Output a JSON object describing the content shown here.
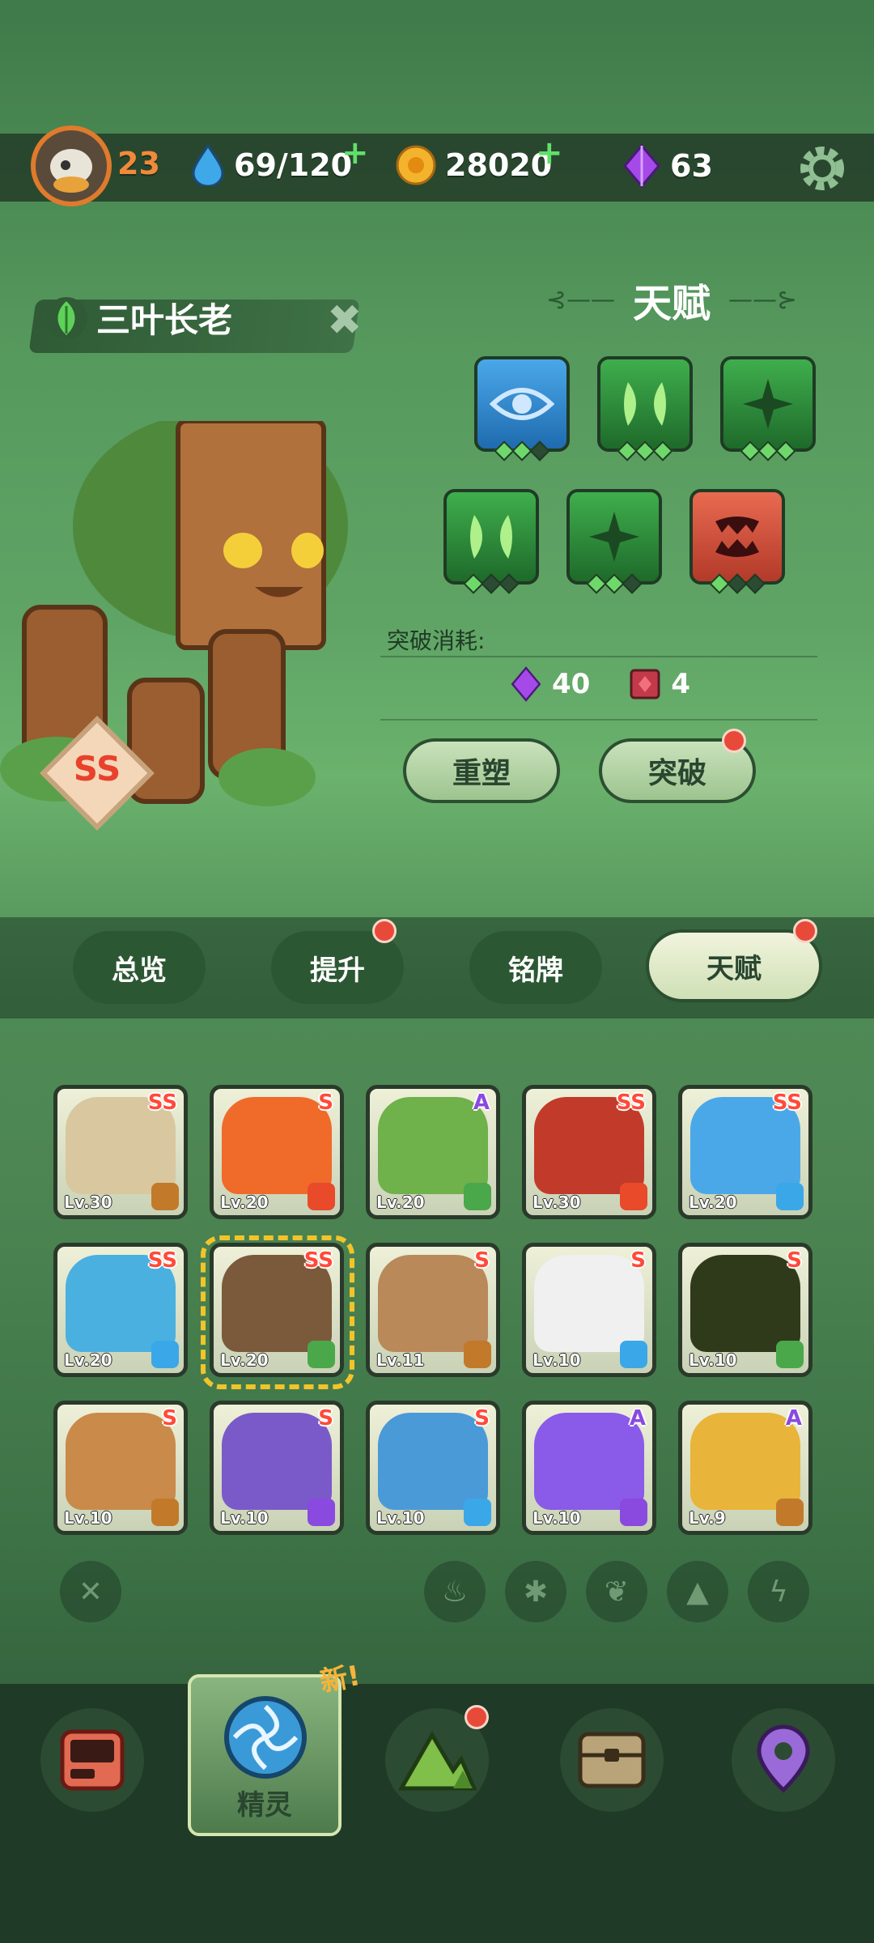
{
  "header": {
    "level": "23",
    "energy": "69/120",
    "coins": "28020",
    "gems": "63"
  },
  "creature": {
    "name": "三叶长老",
    "grade": "SS"
  },
  "talent": {
    "title": "天赋",
    "breakthrough_cost_label": "突破消耗:",
    "cost_gems": "40",
    "cost_items": "4",
    "reshape_label": "重塑",
    "breakthrough_label": "突破"
  },
  "tabs": [
    {
      "label": "总览"
    },
    {
      "label": "提升"
    },
    {
      "label": "铭牌"
    },
    {
      "label": "天赋"
    }
  ],
  "cards": [
    {
      "lv": "Lv.30",
      "grade": "SS"
    },
    {
      "lv": "Lv.20",
      "grade": "S"
    },
    {
      "lv": "Lv.20",
      "grade": "A"
    },
    {
      "lv": "Lv.30",
      "grade": "SS"
    },
    {
      "lv": "Lv.20",
      "grade": "SS"
    },
    {
      "lv": "Lv.20",
      "grade": "SS"
    },
    {
      "lv": "Lv.20",
      "grade": "SS"
    },
    {
      "lv": "Lv.11",
      "grade": "S"
    },
    {
      "lv": "Lv.10",
      "grade": "S"
    },
    {
      "lv": "Lv.10",
      "grade": "S"
    },
    {
      "lv": "Lv.10",
      "grade": "S"
    },
    {
      "lv": "Lv.10",
      "grade": "S"
    },
    {
      "lv": "Lv.10",
      "grade": "S"
    },
    {
      "lv": "Lv.10",
      "grade": "A"
    },
    {
      "lv": "Lv.9",
      "grade": "A"
    }
  ],
  "nav": {
    "new_badge": "新!",
    "spirit_label": "精灵"
  }
}
